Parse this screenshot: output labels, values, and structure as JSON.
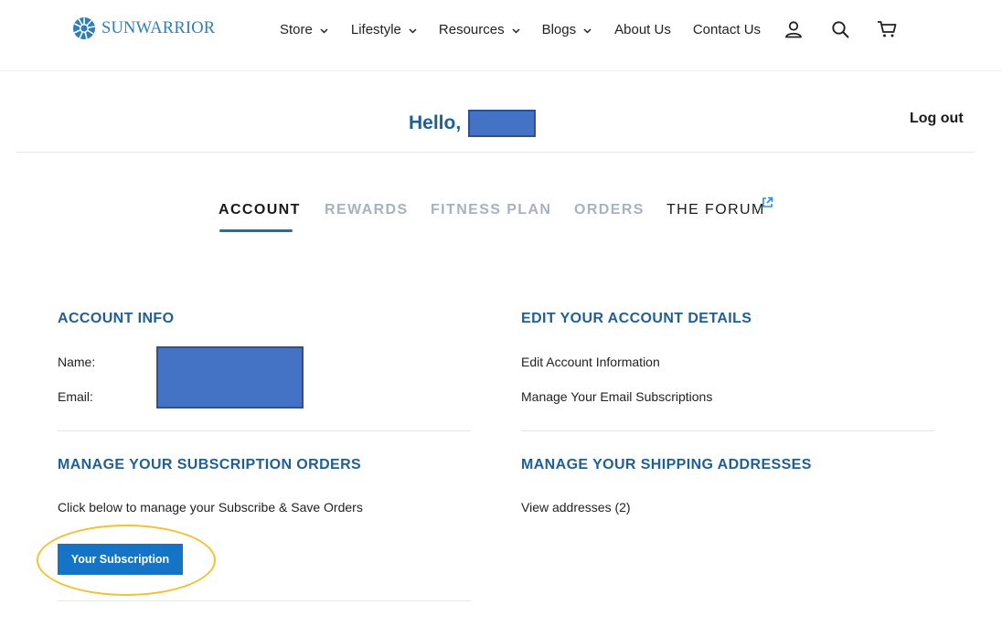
{
  "brand": {
    "name": "SUNWARRIOR",
    "color": "#2f7fb6"
  },
  "nav": {
    "items": [
      {
        "label": "Store",
        "dropdown": true
      },
      {
        "label": "Lifestyle",
        "dropdown": true
      },
      {
        "label": "Resources",
        "dropdown": true
      },
      {
        "label": "Blogs",
        "dropdown": true
      },
      {
        "label": "About Us",
        "dropdown": false
      },
      {
        "label": "Contact Us",
        "dropdown": false
      }
    ],
    "icons": [
      "account-icon",
      "search-icon",
      "cart-icon"
    ]
  },
  "greeting": {
    "text": "Hello,"
  },
  "logout_label": "Log out",
  "tabs": [
    {
      "label": "ACCOUNT",
      "state": "active"
    },
    {
      "label": "REWARDS",
      "state": "inactive"
    },
    {
      "label": "FITNESS PLAN",
      "state": "inactive"
    },
    {
      "label": "ORDERS",
      "state": "inactive"
    },
    {
      "label": "THE FORUM",
      "state": "external"
    }
  ],
  "account_info": {
    "title": "ACCOUNT INFO",
    "name_label": "Name:",
    "email_label": "Email:"
  },
  "edit_details": {
    "title": "EDIT YOUR ACCOUNT DETAILS",
    "links": [
      "Edit Account Information",
      "Manage Your Email Subscriptions"
    ]
  },
  "subscriptions": {
    "title": "MANAGE YOUR SUBSCRIPTION ORDERS",
    "description": "Click below to manage your Subscribe & Save Orders",
    "button_label": "Your Subscription"
  },
  "shipping": {
    "title": "MANAGE YOUR SHIPPING ADDRESSES",
    "link": "View addresses (2)"
  },
  "colors": {
    "heading": "#1f5f95",
    "button": "#1674c6",
    "tab_underline": "#1f6fa8",
    "redaction": "#4472c4",
    "highlight_ring": "#f1c232"
  }
}
